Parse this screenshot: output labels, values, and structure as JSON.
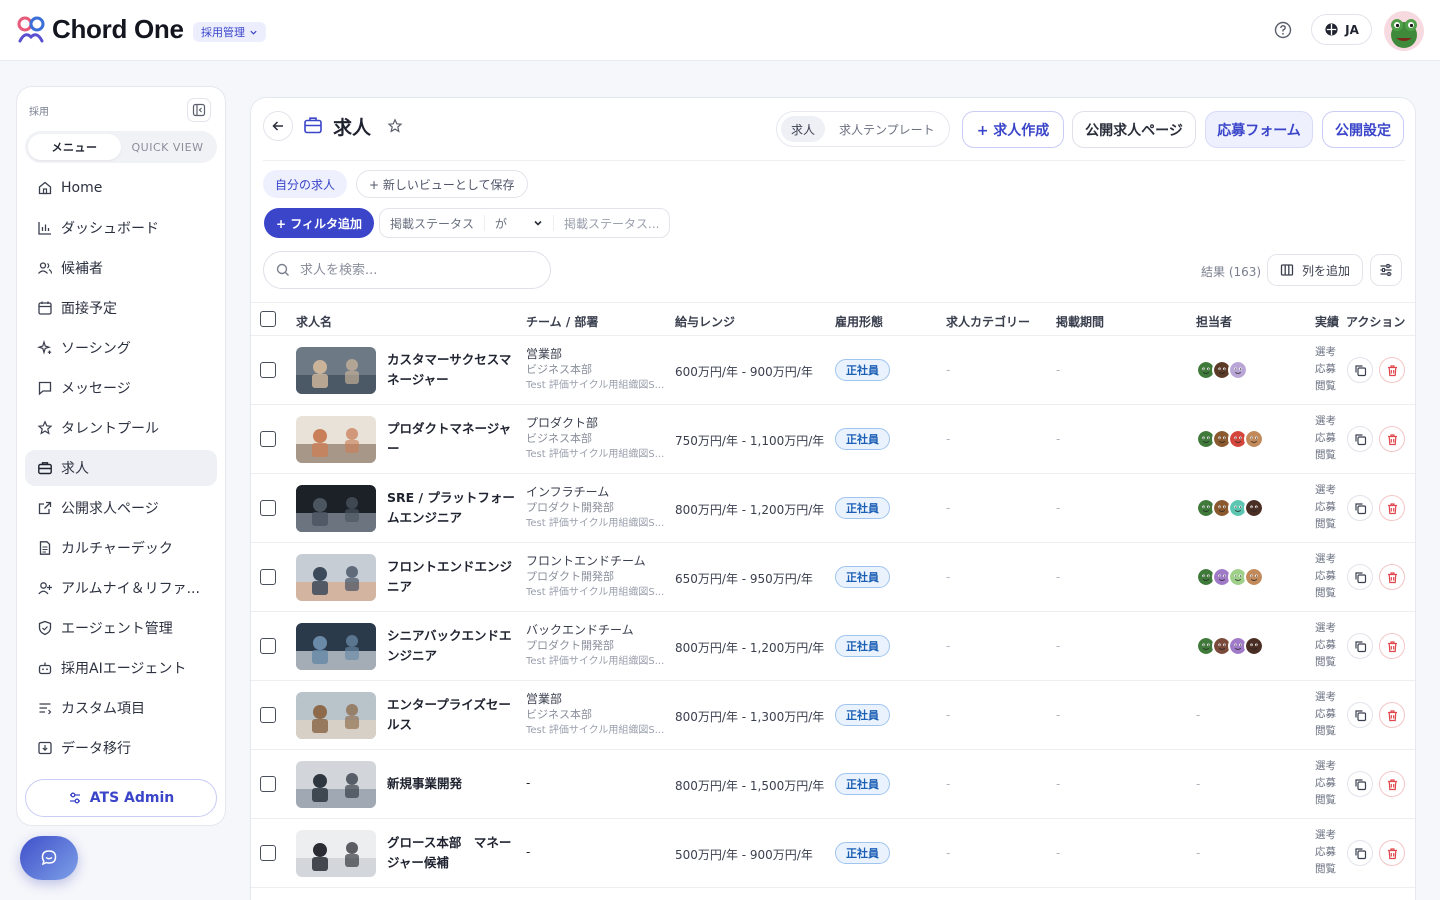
{
  "header": {
    "brand": "Chord One",
    "app_pill": "採用管理",
    "lang": "JA"
  },
  "sidebar": {
    "section": "採用",
    "tabs": [
      "メニュー",
      "QUICK VIEW"
    ],
    "items": [
      {
        "label": "Home",
        "icon": "home-icon"
      },
      {
        "label": "ダッシュボード",
        "icon": "chart-icon"
      },
      {
        "label": "候補者",
        "icon": "users-icon"
      },
      {
        "label": "面接予定",
        "icon": "calendar-icon"
      },
      {
        "label": "ソーシング",
        "icon": "sparkle-icon"
      },
      {
        "label": "メッセージ",
        "icon": "message-icon"
      },
      {
        "label": "タレントプール",
        "icon": "star-icon"
      },
      {
        "label": "求人",
        "icon": "briefcase-icon",
        "active": true
      },
      {
        "label": "公開求人ページ",
        "icon": "external-link-icon"
      },
      {
        "label": "カルチャーデック",
        "icon": "document-icon"
      },
      {
        "label": "アルムナイ＆リファ...",
        "icon": "user-plus-icon"
      },
      {
        "label": "エージェント管理",
        "icon": "shield-icon"
      },
      {
        "label": "採用AIエージェント",
        "icon": "robot-icon"
      },
      {
        "label": "カスタム項目",
        "icon": "list-icon"
      },
      {
        "label": "データ移行",
        "icon": "download-icon"
      }
    ],
    "admin_button": "ATS Admin"
  },
  "main": {
    "title": "求人",
    "segments": [
      "求人",
      "求人テンプレート"
    ],
    "buttons": {
      "create": "+ 求人作成",
      "public_page": "公開求人ページ",
      "form": "応募フォーム",
      "publish": "公開設定"
    },
    "views": {
      "own": "自分の求人",
      "save_new": "+ 新しいビューとして保存"
    },
    "filter": {
      "add": "+ フィルタ追加",
      "field": "掲載ステータス",
      "operator": "が",
      "value_placeholder": "掲載ステータス..."
    },
    "search_placeholder": "求人を検索...",
    "results": "結果 (163)",
    "add_column": "列を追加"
  },
  "table": {
    "columns": [
      "求人名",
      "チーム / 部署",
      "給与レンジ",
      "雇用形態",
      "求人カテゴリー",
      "掲載期間",
      "担当者",
      "実績",
      "アクション"
    ],
    "perf_labels": [
      "選考",
      "応募",
      "閲覧"
    ],
    "rows": [
      {
        "name": "カスタマーサクセスマネージャー",
        "team": "営業部",
        "dept": "ビジネス本部",
        "org": "Test 評価サイクル用組織図S...",
        "salary": "600万円/年 - 900万円/年",
        "type": "正社員",
        "category": "-",
        "period": "-",
        "thumb": [
          "#6d7a86",
          "#c9b49a",
          "#3d4a57"
        ],
        "avatars": [
          "#3f7a3a",
          "#5b3a28",
          "#b9a6d6"
        ]
      },
      {
        "name": "プロダクトマネージャー",
        "team": "プロダクト部",
        "dept": "ビジネス本部",
        "org": "Test 評価サイクル用組織図S...",
        "salary": "750万円/年 - 1,100万円/年",
        "type": "正社員",
        "category": "-",
        "period": "-",
        "thumb": [
          "#e8e2d8",
          "#c97f5a",
          "#8a7866"
        ],
        "avatars": [
          "#3f7a3a",
          "#8a5a2e",
          "#d4463c",
          "#c28a5a"
        ]
      },
      {
        "name": "SRE / プラットフォームエンジニア",
        "team": "インフラチーム",
        "dept": "プロダクト開発部",
        "org": "Test 評価サイクル用組織図S...",
        "salary": "800万円/年 - 1,200万円/年",
        "type": "正社員",
        "category": "-",
        "period": "-",
        "thumb": [
          "#1c2128",
          "#4b5560",
          "#8e9aa4"
        ],
        "avatars": [
          "#3f7a3a",
          "#8a5a2e",
          "#5cc6b0",
          "#4a2e24"
        ]
      },
      {
        "name": "フロントエンドエンジニア",
        "team": "フロントエンドチーム",
        "dept": "プロダクト開発部",
        "org": "Test 評価サイクル用組織図S...",
        "salary": "650万円/年 - 950万円/年",
        "type": "正社員",
        "category": "-",
        "period": "-",
        "thumb": [
          "#c7cdd4",
          "#3c4a5c",
          "#d9a98a"
        ],
        "avatars": [
          "#3f7a3a",
          "#a07ac8",
          "#9ed08a",
          "#c28a5a"
        ]
      },
      {
        "name": "シニアバックエンドエンジニア",
        "team": "バックエンドチーム",
        "dept": "プロダクト開発部",
        "org": "Test 評価サイクル用組織図S...",
        "salary": "800万円/年 - 1,200万円/年",
        "type": "正社員",
        "category": "-",
        "period": "-",
        "thumb": [
          "#2a3a4a",
          "#6a8aa8",
          "#d8dde2"
        ],
        "avatars": [
          "#3f7a3a",
          "#7a4a3a",
          "#a07ac8",
          "#4a2e24"
        ]
      },
      {
        "name": "エンタープライズセールス",
        "team": "営業部",
        "dept": "ビジネス本部",
        "org": "Test 評価サイクル用組織図S...",
        "salary": "800万円/年 - 1,300万円/年",
        "type": "正社員",
        "category": "-",
        "period": "-",
        "owner": "-",
        "thumb": [
          "#b9c3ca",
          "#8c6a4a",
          "#e4d6c4"
        ],
        "avatars": []
      },
      {
        "name": "新規事業開発",
        "team": "-",
        "salary": "800万円/年 - 1,500万円/年",
        "type": "正社員",
        "category": "-",
        "period": "-",
        "owner": "-",
        "thumb": [
          "#d2d6da",
          "#2e3640",
          "#8a96a2"
        ],
        "avatars": []
      },
      {
        "name": "グロース本部　マネージャー候補",
        "team": "-",
        "salary": "500万円/年 - 900万円/年",
        "type": "正社員",
        "category": "-",
        "period": "-",
        "owner": "-",
        "thumb": [
          "#eceef0",
          "#2a2e34",
          "#c9cdd2"
        ],
        "avatars": []
      }
    ]
  },
  "colors": {
    "accent": "#3a45c9",
    "badge_bg": "#eaf3fd",
    "badge_text": "#1b5fb5",
    "danger": "#e0474c"
  }
}
